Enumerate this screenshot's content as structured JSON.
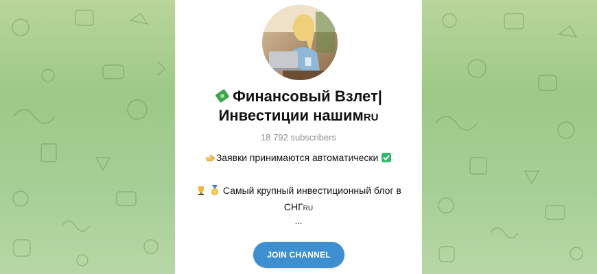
{
  "channel": {
    "title_line1": "Финансовый Взлет|",
    "title_line2": "Инвестиции нашим",
    "title_suffix": "RU",
    "subscribers": "18 792 subscribers",
    "description_line1": "Заявки принимаются автоматически",
    "description_line2": "Самый крупный инвестиционный блог в СНГ",
    "description_line2_suffix": "RU",
    "ellipsis": "..."
  },
  "actions": {
    "join_label": "JOIN CHANNEL"
  },
  "icons": {
    "title_icon": "money-with-wings-icon",
    "point_icon": "pointing-hand-icon",
    "check_icon": "check-mark-icon",
    "trophy_icon": "trophy-icon",
    "medal_icon": "medal-icon"
  },
  "colors": {
    "accent": "#3d8fd0",
    "background_green": "#a6cf97",
    "subtext": "#8a8f94"
  }
}
